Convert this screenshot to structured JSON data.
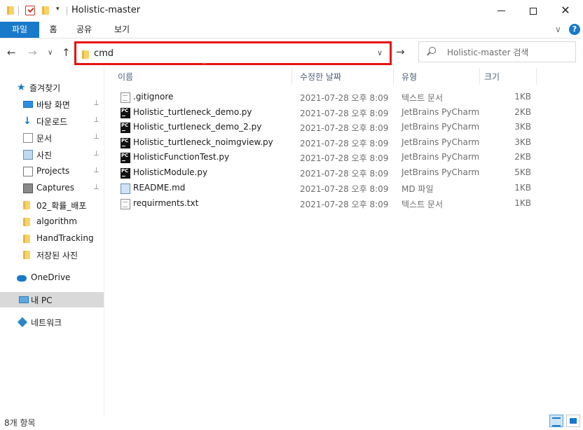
{
  "window": {
    "title": "Holistic-master",
    "minimize_glyph": "—",
    "maximize_glyph": "☐",
    "close_glyph": "✕",
    "quick_access_dropdown": "▾"
  },
  "ribbon": {
    "tabs": [
      {
        "label": "파일",
        "active": true
      },
      {
        "label": "홈"
      },
      {
        "label": "공유"
      },
      {
        "label": "보기"
      }
    ],
    "collapse_glyph": "∨",
    "help_glyph": "?"
  },
  "nav": {
    "back_glyph": "←",
    "forward_glyph": "→",
    "recent_glyph": "∨",
    "up_glyph": "↑",
    "address_text": "cmd",
    "address_dropdown_glyph": "∨",
    "go_glyph": "→",
    "search_placeholder": "Holistic-master 검색",
    "highlight_color": "#e81010"
  },
  "sidebar": {
    "pin_glyph": "📌",
    "items": [
      {
        "label": "즐겨찾기",
        "icon": "star-icon"
      },
      {
        "label": "바탕 화면",
        "icon": "desktop-icon",
        "pinned": true
      },
      {
        "label": "다운로드",
        "icon": "download-icon",
        "pinned": true
      },
      {
        "label": "문서",
        "icon": "document-icon",
        "pinned": true
      },
      {
        "label": "사진",
        "icon": "pictures-icon",
        "pinned": true
      },
      {
        "label": "Projects",
        "icon": "clipboard-icon",
        "pinned": true
      },
      {
        "label": "Captures",
        "icon": "captures-icon",
        "pinned": true
      },
      {
        "label": "02_확률_배포",
        "icon": "folder-icon"
      },
      {
        "label": "algorithm",
        "icon": "folder-icon"
      },
      {
        "label": "HandTracking",
        "icon": "folder-icon"
      },
      {
        "label": "저장된 사진",
        "icon": "folder-icon"
      },
      {
        "label": "OneDrive",
        "icon": "onedrive-icon"
      },
      {
        "label": "내 PC",
        "icon": "this-pc-icon",
        "selected": true
      },
      {
        "label": "네트워크",
        "icon": "network-icon"
      }
    ]
  },
  "columns": {
    "name": "이름",
    "modified": "수정한 날짜",
    "type": "유형",
    "size": "크기",
    "sort_glyph": "^"
  },
  "files": [
    {
      "name": ".gitignore",
      "modified": "2021-07-28 오후 8:09",
      "type": "텍스트 문서",
      "size": "1KB",
      "icon": "text-file-icon"
    },
    {
      "name": "Holistic_turtleneck_demo.py",
      "modified": "2021-07-28 오후 8:09",
      "type": "JetBrains PyCharm",
      "size": "2KB",
      "icon": "pycharm-file-icon"
    },
    {
      "name": "Holistic_turtleneck_demo_2.py",
      "modified": "2021-07-28 오후 8:09",
      "type": "JetBrains PyCharm",
      "size": "3KB",
      "icon": "pycharm-file-icon"
    },
    {
      "name": "Holistic_turtleneck_noimgview.py",
      "modified": "2021-07-28 오후 8:09",
      "type": "JetBrains PyCharm",
      "size": "3KB",
      "icon": "pycharm-file-icon"
    },
    {
      "name": "HolisticFunctionTest.py",
      "modified": "2021-07-28 오후 8:09",
      "type": "JetBrains PyCharm",
      "size": "2KB",
      "icon": "pycharm-file-icon"
    },
    {
      "name": "HolisticModule.py",
      "modified": "2021-07-28 오후 8:09",
      "type": "JetBrains PyCharm",
      "size": "5KB",
      "icon": "pycharm-file-icon"
    },
    {
      "name": "README.md",
      "modified": "2021-07-28 오후 8:09",
      "type": "MD 파일",
      "size": "1KB",
      "icon": "markdown-file-icon"
    },
    {
      "name": "requirments.txt",
      "modified": "2021-07-28 오후 8:09",
      "type": "텍스트 문서",
      "size": "1KB",
      "icon": "text-file-icon"
    }
  ],
  "status": {
    "item_count": "8개 항목"
  }
}
